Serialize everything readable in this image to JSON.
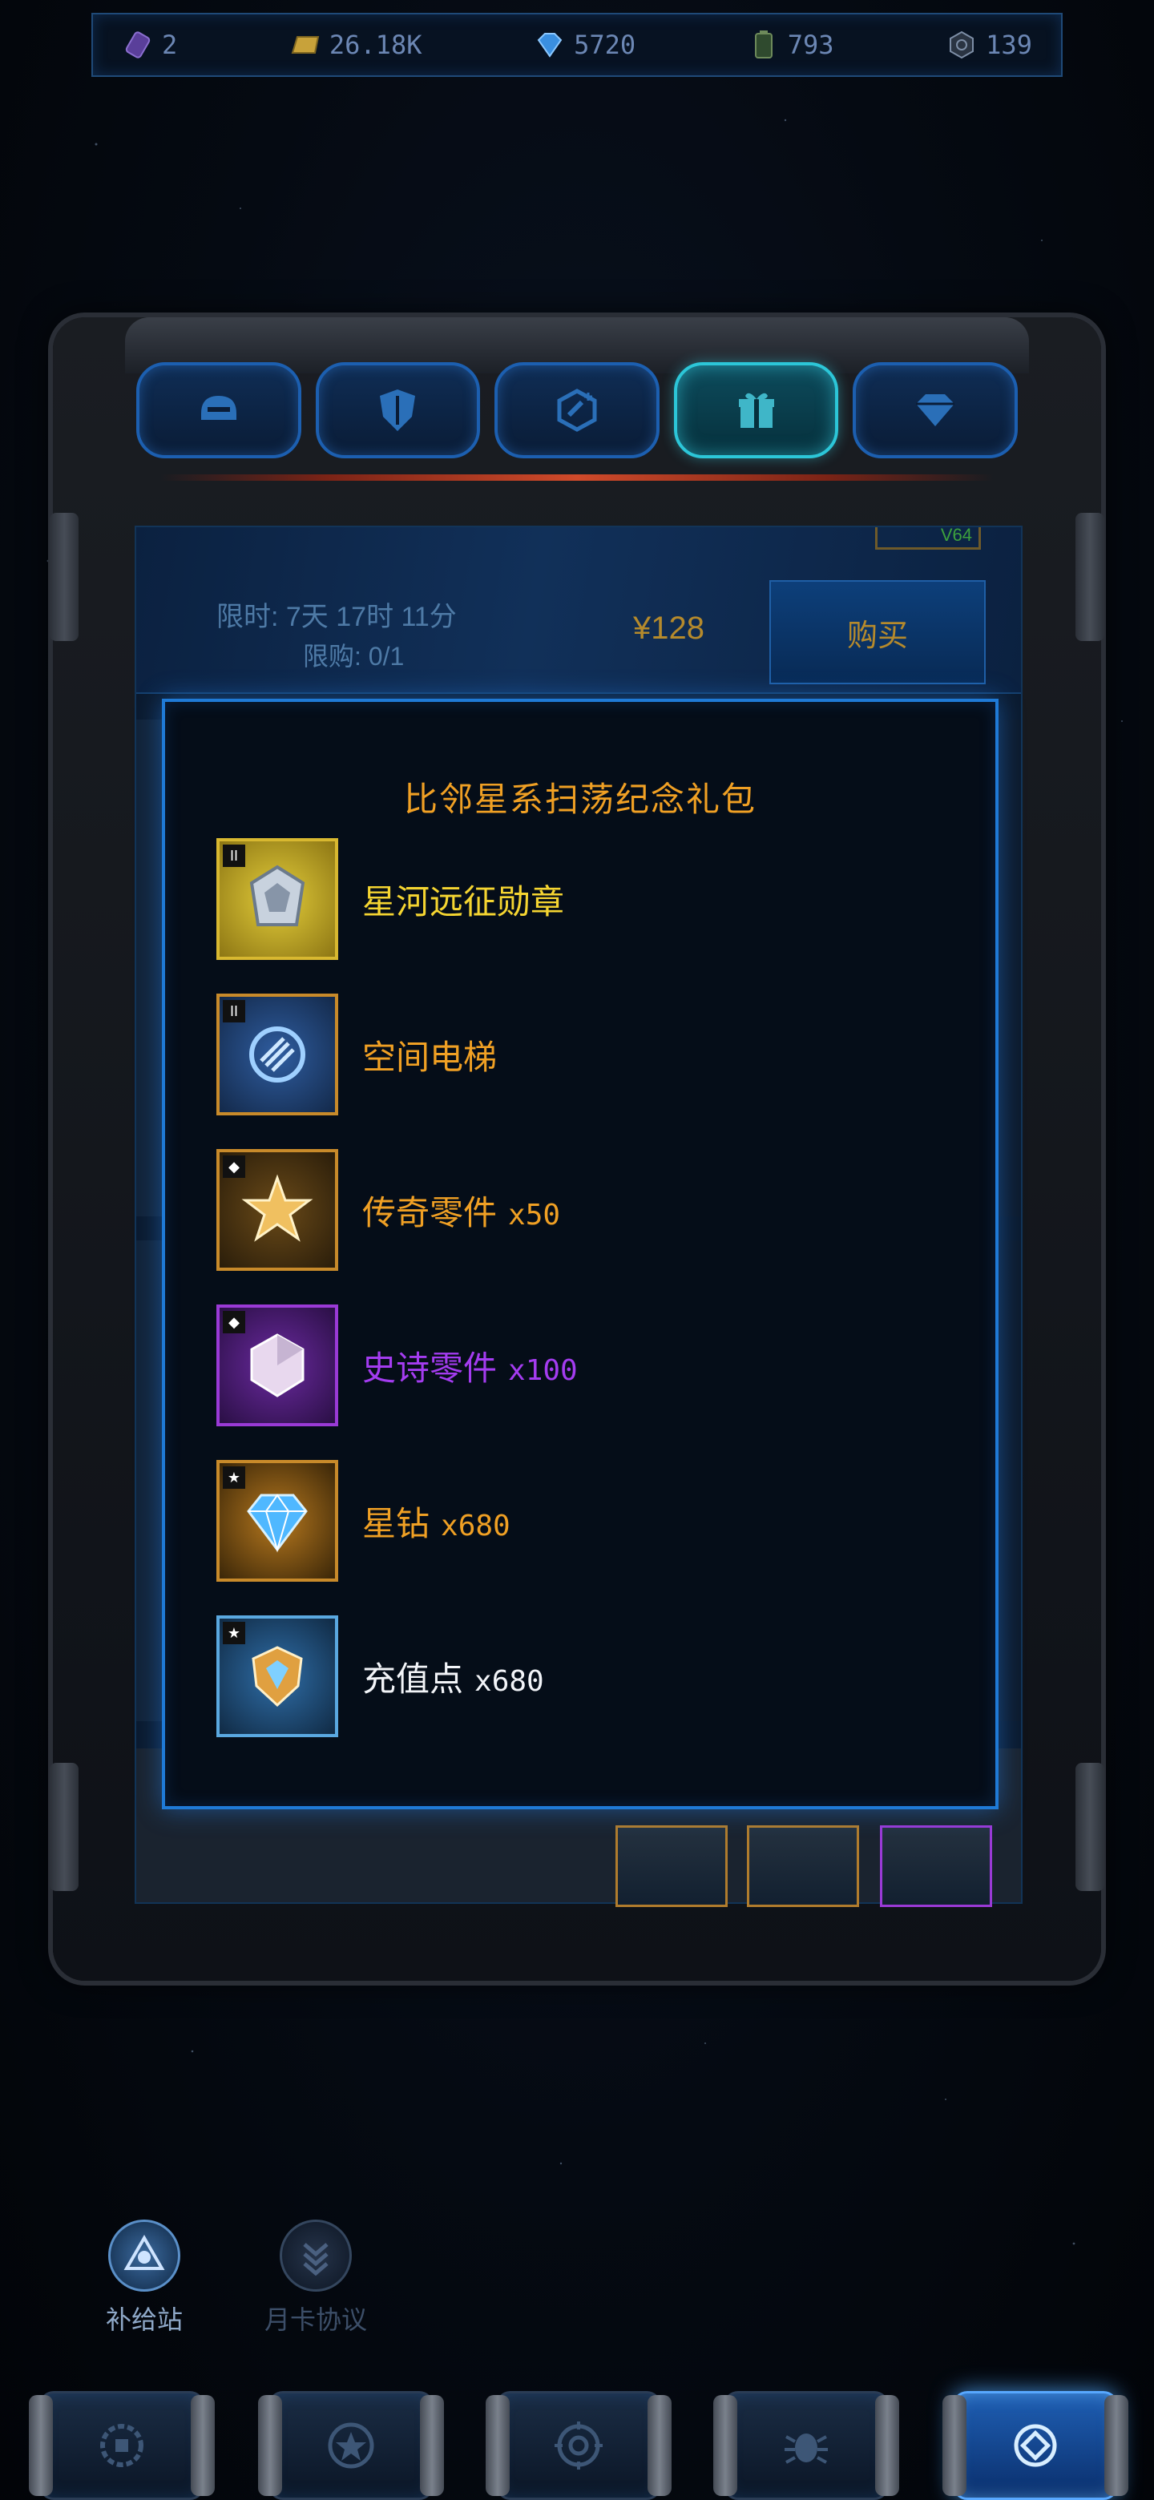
{
  "currencies": [
    {
      "icon": "energy-chip-icon",
      "value": "2"
    },
    {
      "icon": "gold-bar-icon",
      "value": "26.18K"
    },
    {
      "icon": "diamond-icon",
      "value": "5720"
    },
    {
      "icon": "battery-icon",
      "value": "793"
    },
    {
      "icon": "alloy-icon",
      "value": "139"
    }
  ],
  "tabs": [
    {
      "icon": "helmet-icon",
      "active": false
    },
    {
      "icon": "shield-icon",
      "active": false
    },
    {
      "icon": "badge-plus-icon",
      "active": false
    },
    {
      "icon": "gift-icon",
      "active": true
    },
    {
      "icon": "gem-icon",
      "active": false
    }
  ],
  "offer": {
    "timer_text": "限时: 7天 17时 11分",
    "limit_text": "限购: 0/1",
    "price": "¥128",
    "buy_label": "购买",
    "corner_tag": "V64"
  },
  "modal": {
    "title": "比邻星系扫荡纪念礼包",
    "items": [
      {
        "name": "星河远征勋章",
        "qty": "",
        "name_color": "#f5d531",
        "border": "#d8b830",
        "bg": "#b59a1a",
        "tag": "II",
        "icon": "medal-icon"
      },
      {
        "name": "空间电梯",
        "qty": "",
        "name_color": "#f0a024",
        "border": "#c88a2a",
        "bg": "#243a5c",
        "tag": "II",
        "icon": "elevator-icon"
      },
      {
        "name": "传奇零件",
        "qty": "x50",
        "name_color": "#f0a024",
        "border": "#c88a2a",
        "bg": "#3b3020",
        "tag": "◆",
        "icon": "legend-part-icon"
      },
      {
        "name": "史诗零件",
        "qty": "x100",
        "name_color": "#a43cf0",
        "border": "#9a3ad6",
        "bg": "#3a1a55",
        "tag": "◆",
        "icon": "epic-part-icon"
      },
      {
        "name": "星钻",
        "qty": "x680",
        "name_color": "#f0a024",
        "border": "#c88a2a",
        "bg": "#3a2a12",
        "tag": "★",
        "icon": "star-diamond-icon"
      },
      {
        "name": "充值点",
        "qty": "x680",
        "name_color": "#f2f4f8",
        "border": "#5aa8e0",
        "bg": "#1a3a5a",
        "tag": "★",
        "icon": "recharge-point-icon"
      }
    ]
  },
  "subnav": [
    {
      "label": "补给站",
      "active": true
    },
    {
      "label": "月卡协议",
      "active": false
    }
  ],
  "dock": [
    {
      "icon": "base-icon",
      "active": false
    },
    {
      "icon": "star-badge-icon",
      "active": false
    },
    {
      "icon": "target-icon",
      "active": false
    },
    {
      "icon": "bug-icon",
      "active": false
    },
    {
      "icon": "shop-icon",
      "active": true
    }
  ]
}
